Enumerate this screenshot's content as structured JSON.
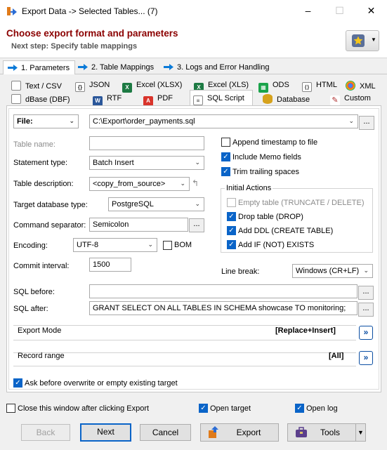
{
  "window": {
    "title": "Export Data -> Selected Tables... (7)",
    "minimize": "–",
    "maximize": "☐",
    "close": "✕"
  },
  "header": {
    "title": "Choose export format and parameters",
    "subtitle": "Next step: Specify table mappings"
  },
  "steps": [
    {
      "label": "1. Parameters"
    },
    {
      "label": "2. Table Mappings"
    },
    {
      "label": "3. Logs and Error Handling"
    }
  ],
  "formats_row1": [
    "Text / CSV",
    "JSON",
    "Excel (XLSX)",
    "Excel (XLS)",
    "ODS",
    "HTML",
    "XML"
  ],
  "formats_row2": [
    "dBase (DBF)",
    "RTF",
    "PDF",
    "SQL Script",
    "Database",
    "Custom"
  ],
  "form": {
    "file_select": "File:",
    "file_path": "C:\\Export\\order_payments.sql",
    "table_name_label": "Table name:",
    "statement_type_label": "Statement type:",
    "statement_type": "Batch Insert",
    "table_desc_label": "Table description:",
    "table_desc": "<copy_from_source>",
    "target_db_label": "Target database type:",
    "target_db": "PostgreSQL",
    "cmd_sep_label": "Command separator:",
    "cmd_sep": "Semicolon",
    "encoding_label": "Encoding:",
    "encoding": "UTF-8",
    "bom_label": "BOM",
    "commit_label": "Commit interval:",
    "commit_value": "1500",
    "line_break_label": "Line break:",
    "line_break": "Windows (CR+LF)",
    "sql_before_label": "SQL before:",
    "sql_before": "",
    "sql_after_label": "SQL after:",
    "sql_after": "GRANT SELECT ON ALL TABLES IN SCHEMA showcase TO monitoring;",
    "dots": "..."
  },
  "options": {
    "append_timestamp": "Append timestamp to file",
    "include_memo": "Include Memo fields",
    "trim_trailing": "Trim trailing spaces",
    "initial_actions": "Initial Actions",
    "empty_table": "Empty table (TRUNCATE / DELETE)",
    "drop_table": "Drop table (DROP)",
    "add_ddl": "Add DDL (CREATE TABLE)",
    "add_if_exists": "Add IF (NOT) EXISTS"
  },
  "sections": {
    "export_mode_label": "Export Mode",
    "export_mode_value": "[Replace+Insert]",
    "record_range_label": "Record range",
    "record_range_value": "[All]",
    "expand": "»"
  },
  "ask_overwrite": "Ask before overwrite or empty existing target",
  "footer": {
    "close_after": "Close this window after clicking Export",
    "open_target": "Open target",
    "open_log": "Open log",
    "back": "Back",
    "next": "Next",
    "cancel": "Cancel",
    "export": "Export",
    "tools": "Tools"
  },
  "colors": {
    "header_title": "#8b0000",
    "accent": "#0a64c8"
  }
}
